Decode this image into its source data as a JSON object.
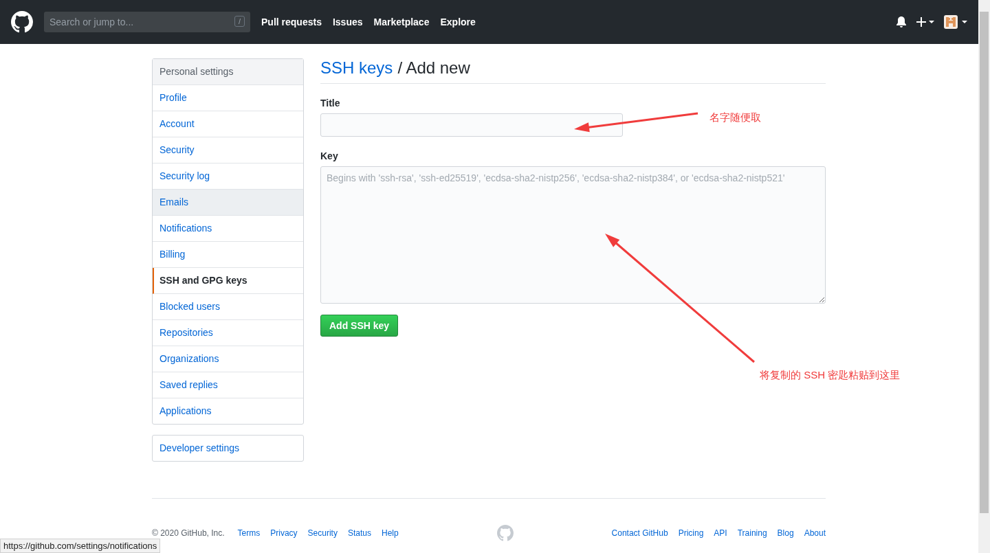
{
  "header": {
    "search": {
      "placeholder": "Search or jump to...",
      "shortcut": "/"
    },
    "nav": [
      "Pull requests",
      "Issues",
      "Marketplace",
      "Explore"
    ]
  },
  "sidebar": {
    "heading": "Personal settings",
    "items": [
      {
        "label": "Profile",
        "selected": false,
        "highlighted": false
      },
      {
        "label": "Account",
        "selected": false,
        "highlighted": false
      },
      {
        "label": "Security",
        "selected": false,
        "highlighted": false
      },
      {
        "label": "Security log",
        "selected": false,
        "highlighted": false
      },
      {
        "label": "Emails",
        "selected": false,
        "highlighted": true
      },
      {
        "label": "Notifications",
        "selected": false,
        "highlighted": false
      },
      {
        "label": "Billing",
        "selected": false,
        "highlighted": false
      },
      {
        "label": "SSH and GPG keys",
        "selected": true,
        "highlighted": false
      },
      {
        "label": "Blocked users",
        "selected": false,
        "highlighted": false
      },
      {
        "label": "Repositories",
        "selected": false,
        "highlighted": false
      },
      {
        "label": "Organizations",
        "selected": false,
        "highlighted": false
      },
      {
        "label": "Saved replies",
        "selected": false,
        "highlighted": false
      },
      {
        "label": "Applications",
        "selected": false,
        "highlighted": false
      }
    ],
    "developer_settings": "Developer settings"
  },
  "page": {
    "breadcrumb_link": "SSH keys",
    "title": "/ Add new"
  },
  "form": {
    "title_label": "Title",
    "key_label": "Key",
    "key_placeholder": "Begins with 'ssh-rsa', 'ssh-ed25519', 'ecdsa-sha2-nistp256', 'ecdsa-sha2-nistp384', or 'ecdsa-sha2-nistp521'",
    "submit": "Add SSH key"
  },
  "annotations": [
    {
      "text": "名字随便取"
    },
    {
      "text": "将复制的 SSH 密匙粘贴到这里"
    }
  ],
  "footer": {
    "copyright": "© 2020 GitHub, Inc.",
    "left_links": [
      "Terms",
      "Privacy",
      "Security",
      "Status",
      "Help"
    ],
    "right_links": [
      "Contact GitHub",
      "Pricing",
      "API",
      "Training",
      "Blog",
      "About"
    ]
  },
  "status_url": "https://github.com/settings/notifications"
}
